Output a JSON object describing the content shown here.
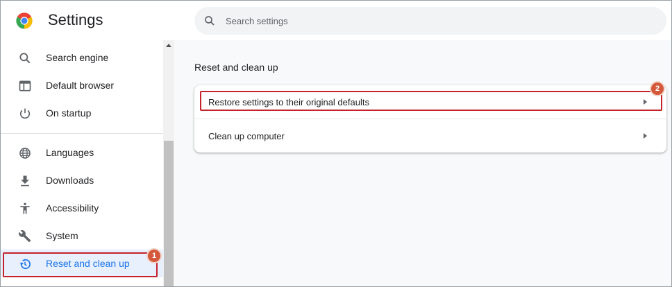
{
  "header": {
    "title": "Settings",
    "logo_icon": "chrome-logo-icon",
    "search": {
      "placeholder": "Search settings",
      "icon": "search-icon"
    }
  },
  "sidebar": {
    "items": [
      {
        "label": "Search engine",
        "icon": "search-icon"
      },
      {
        "label": "Default browser",
        "icon": "browser-window-icon"
      },
      {
        "label": "On startup",
        "icon": "power-icon"
      },
      {
        "label": "Languages",
        "icon": "globe-icon"
      },
      {
        "label": "Downloads",
        "icon": "download-icon"
      },
      {
        "label": "Accessibility",
        "icon": "accessibility-icon"
      },
      {
        "label": "System",
        "icon": "wrench-icon"
      },
      {
        "label": "Reset and clean up",
        "icon": "restore-icon",
        "active": true
      }
    ]
  },
  "main": {
    "section_title": "Reset and clean up",
    "rows": [
      {
        "label": "Restore settings to their original defaults",
        "icon": "arrow-right-icon"
      },
      {
        "label": "Clean up computer",
        "icon": "arrow-right-icon"
      }
    ]
  },
  "annotations": {
    "badge_1": "1",
    "badge_2": "2",
    "highlight_color": "#c5232b",
    "badge_color": "#d4593b"
  },
  "colors": {
    "accent": "#1a73e8",
    "active_bg": "#e8f0fe",
    "page_bg": "#f8f9fa"
  }
}
